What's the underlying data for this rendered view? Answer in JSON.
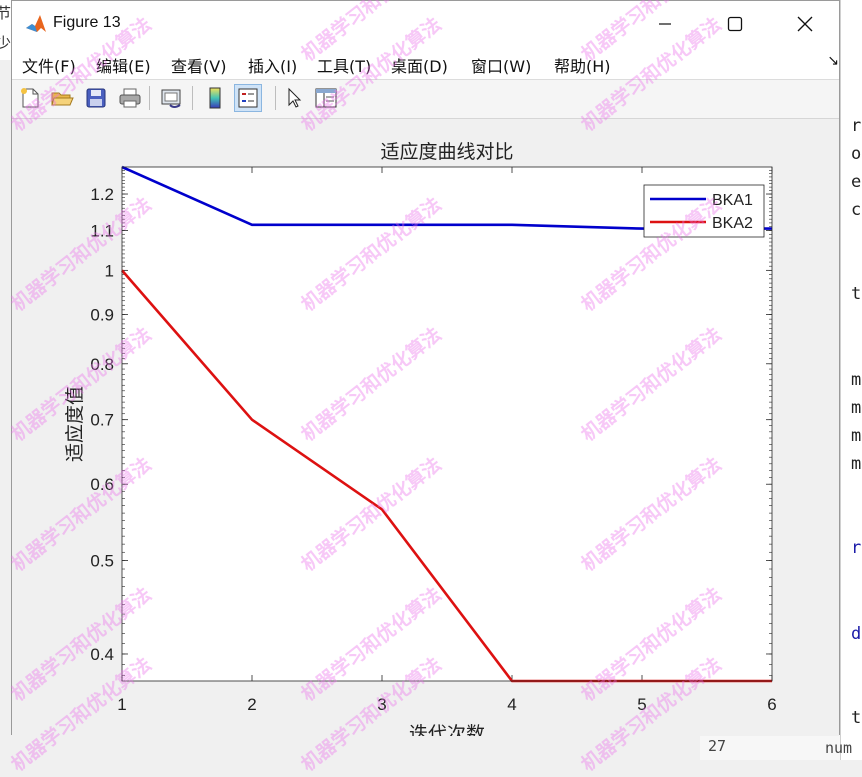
{
  "window": {
    "title": "Figure 13",
    "menu": [
      "文件(F)",
      "编辑(E)",
      "查看(V)",
      "插入(I)",
      "工具(T)",
      "桌面(D)",
      "窗口(W)",
      "帮助(H)"
    ],
    "menu_more": "↘"
  },
  "toolbar": {
    "icons": [
      "new-figure-icon",
      "open-file-icon",
      "save-icon",
      "print-icon",
      "link-plot-icon",
      "colorbar-icon",
      "legend-icon",
      "pointer-icon",
      "property-editor-icon"
    ]
  },
  "watermark": "机器学习和优化算法",
  "background": {
    "right_chars": [
      "r",
      "o",
      "e",
      "c",
      "t",
      "m",
      "m",
      "m",
      "m",
      "r",
      "d",
      "t"
    ],
    "left_chars": [
      "节",
      "少"
    ],
    "bottom_text": [
      "27",
      "num"
    ]
  },
  "chart_data": {
    "type": "line",
    "title": "适应度曲线对比",
    "xlabel": "迭代次数",
    "ylabel": "适应度值",
    "x": [
      1,
      2,
      3,
      4,
      5,
      6
    ],
    "xlim": [
      1,
      6
    ],
    "ylim": [
      0.375,
      1.28
    ],
    "yscale": "log",
    "xticks": [
      "1",
      "2",
      "3",
      "4",
      "5",
      "6"
    ],
    "yticks": [
      {
        "value": 0.4,
        "label": "0.4"
      },
      {
        "value": 0.5,
        "label": "0.5"
      },
      {
        "value": 0.6,
        "label": "0.6"
      },
      {
        "value": 0.7,
        "label": "0.7"
      },
      {
        "value": 0.8,
        "label": "0.8"
      },
      {
        "value": 0.9,
        "label": "0.9"
      },
      {
        "value": 1.0,
        "label": "1"
      },
      {
        "value": 1.1,
        "label": "1.1"
      },
      {
        "value": 1.2,
        "label": "1.2"
      }
    ],
    "grid": false,
    "legend_position": "top-right",
    "series": [
      {
        "name": "BKA1",
        "color": "#0000cc",
        "values": [
          1.28,
          1.115,
          1.115,
          1.115,
          1.105,
          1.105
        ]
      },
      {
        "name": "BKA2",
        "color": "#dd1111",
        "values": [
          1.0,
          0.7,
          0.565,
          0.375,
          0.375,
          0.375
        ]
      }
    ]
  }
}
